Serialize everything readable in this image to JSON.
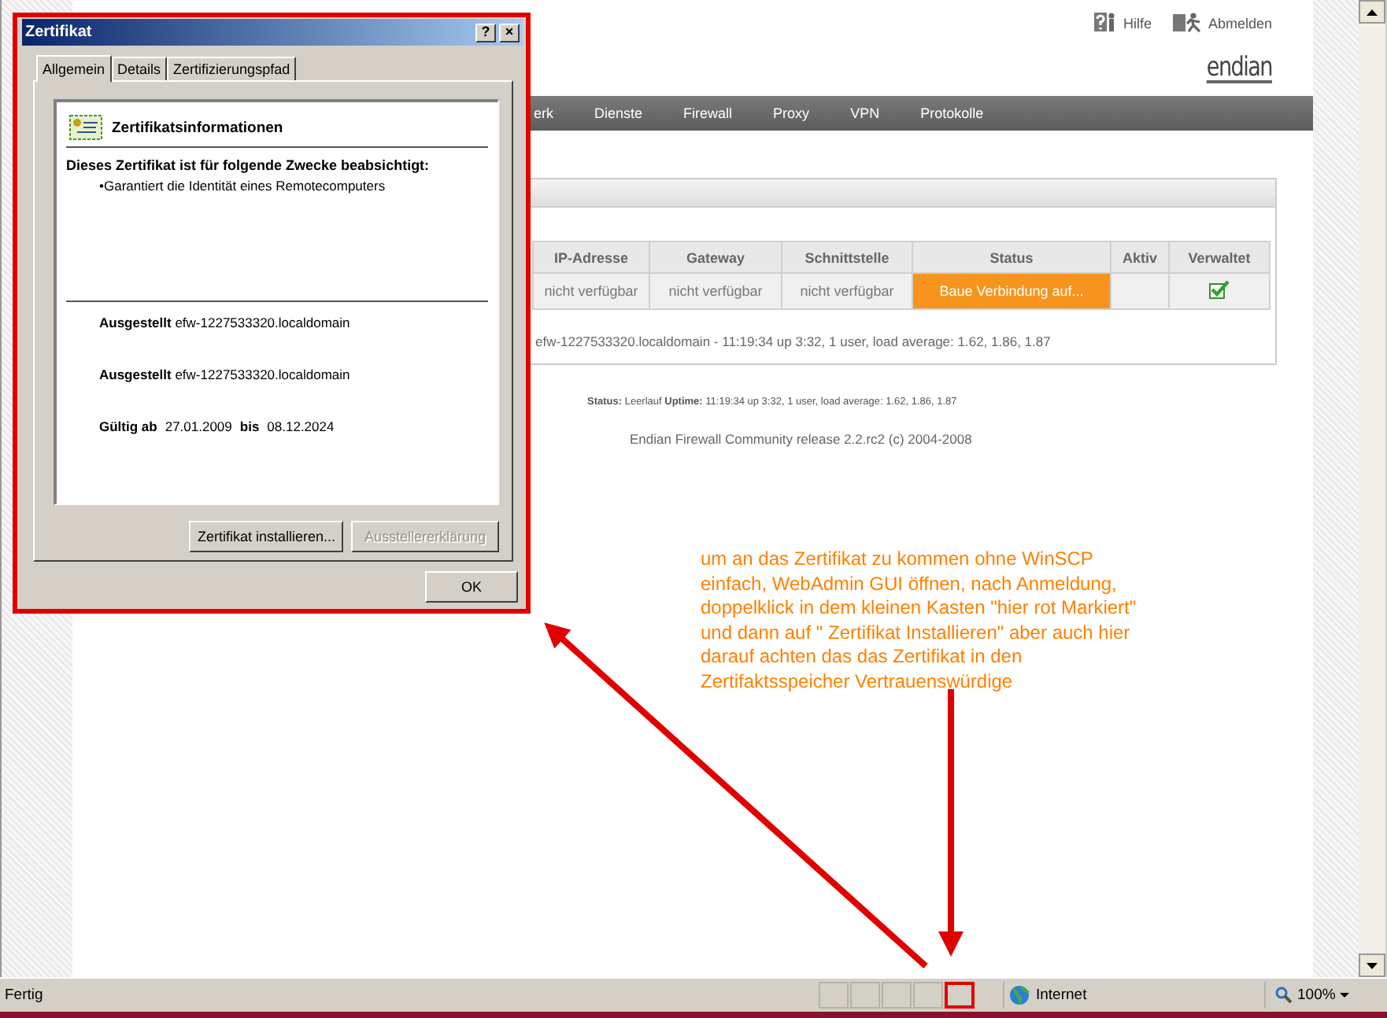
{
  "header": {
    "links": [
      {
        "kind": "help",
        "label": "Hilfe"
      },
      {
        "kind": "logout",
        "label": "Abmelden"
      }
    ],
    "logo": "endian"
  },
  "nav": {
    "items": [
      {
        "label": "erk"
      },
      {
        "label": "Dienste"
      },
      {
        "label": "Firewall"
      },
      {
        "label": "Proxy"
      },
      {
        "label": "VPN"
      },
      {
        "label": "Protokolle"
      }
    ]
  },
  "table": {
    "columns": [
      "IP-Adresse",
      "Gateway",
      "Schnittstelle",
      "Status",
      "Aktiv",
      "Verwaltet"
    ],
    "rows": [
      {
        "cells": [
          {
            "kind": "text",
            "text": "nicht verfügbar"
          },
          {
            "kind": "text",
            "text": "nicht verfügbar"
          },
          {
            "kind": "text",
            "text": "nicht verfügbar"
          },
          {
            "kind": "status",
            "text": "Baue Verbindung auf..."
          },
          {
            "kind": "empty"
          },
          {
            "kind": "check",
            "checked": true
          }
        ]
      }
    ]
  },
  "uptime": "efw-1227533320.localdomain - 11:19:34 up 3:32, 1 user, load average: 1.62, 1.86, 1.87",
  "status_line": "**Status:** Leerlauf **Uptime:** 11:19:34 up 3:32, 1 user, load average: 1.62, 1.86, 1.87",
  "footer": "Endian Firewall Community release 2.2.rc2 (c) 2004-2008",
  "dialog": {
    "title": "Zertifikat",
    "title_buttons": [
      "?",
      "×"
    ],
    "tabs": [
      {
        "label": "Allgemein",
        "selected": true
      },
      {
        "label": "Details",
        "selected": false
      },
      {
        "label": "Zertifizierungspfad",
        "selected": false
      }
    ],
    "heading": "Zertifikatsinformationen",
    "purpose_heading": "Dieses Zertifikat ist für folgende Zwecke beabsichtigt:",
    "purposes": [
      "•Garantiert die Identität eines Remotecomputers"
    ],
    "fields": [
      {
        "label": "Ausgestellt",
        "value": "efw-1227533320.localdomain"
      },
      {
        "label": "Ausgestellt",
        "value": "efw-1227533320.localdomain"
      }
    ],
    "validity": {
      "from_label": "Gültig ab",
      "from": "27.01.2009",
      "to_label": "bis",
      "to": "08.12.2024"
    },
    "buttons": [
      {
        "label": "Zertifikat installieren...",
        "disabled": false
      },
      {
        "label": "Ausstellererklärung",
        "disabled": true
      }
    ],
    "ok": "OK"
  },
  "annotation": {
    "lines": [
      "um an das Zertifikat zu kommen ohne WinSCP",
      "einfach, WebAdmin GUI öffnen, nach Anmeldung,",
      "doppelklick in dem kleinen Kasten \"hier rot Markiert\"",
      "und dann auf \" Zertifikat Installieren\" aber auch hier",
      "darauf achten das das Zertifikat in den",
      "Zertifaktsspeicher Vertrauenswürdige"
    ]
  },
  "status_bar": {
    "text": "Fertig",
    "panes": [
      {
        "highlighted": false
      },
      {
        "highlighted": false
      },
      {
        "highlighted": false
      },
      {
        "highlighted": false
      },
      {
        "highlighted": true
      }
    ],
    "zone": "Internet",
    "zoom": "100%"
  }
}
